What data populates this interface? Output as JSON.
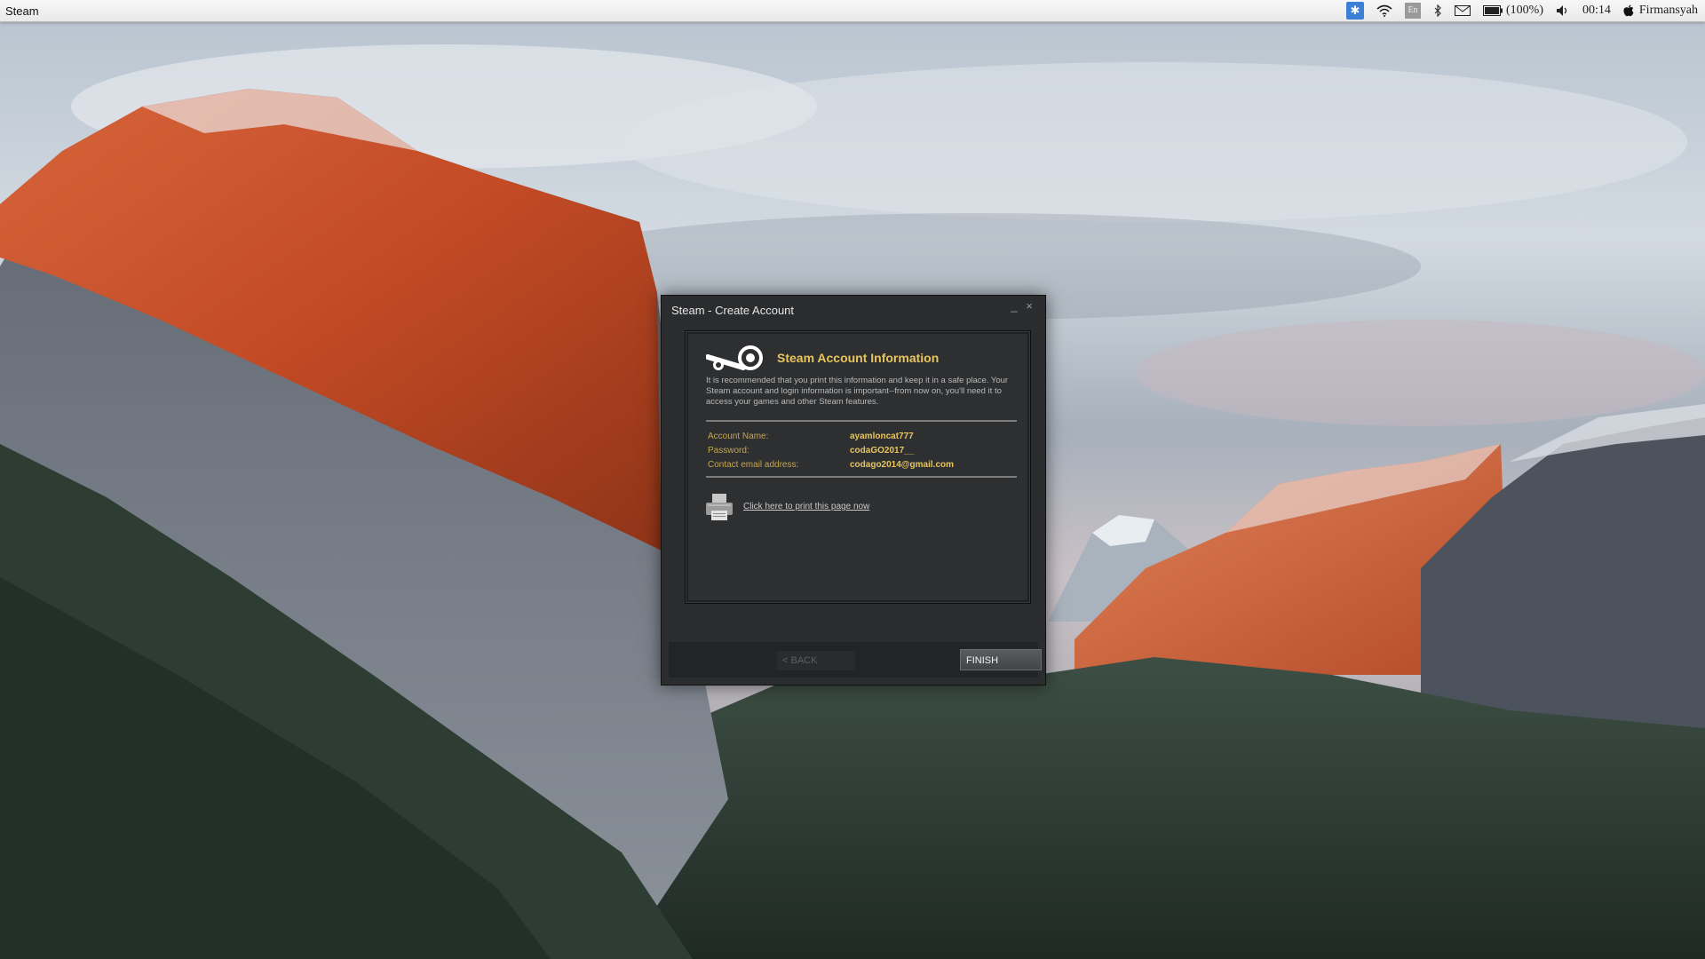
{
  "menubar": {
    "app_name": "Steam",
    "tray": {
      "app_icon": "blue-puzzle-icon",
      "wifi_icon": "wifi-icon",
      "language": "En",
      "bluetooth_icon": "bluetooth-icon",
      "mail_icon": "mail-icon",
      "battery_icon": "battery-icon",
      "battery_text": "(100%)",
      "volume_icon": "speaker-icon",
      "clock": "00:14",
      "apple_icon": "apple-icon",
      "user": "Firmansyah"
    }
  },
  "dialog": {
    "title": "Steam - Create Account",
    "minimize_label": "_",
    "close_label": "×",
    "heading": "Steam Account Information",
    "description": "It is recommended that you print this information and keep it in a safe place. Your Steam account and login information is important--from now on, you'll need it to access your games and other Steam features.",
    "fields": {
      "account_label": "Account Name:",
      "account_value": "ayamloncat777",
      "password_label": "Password:",
      "password_value": "codaGO2017__",
      "email_label": "Contact email address:",
      "email_value": "codago2014@gmail.com"
    },
    "print_link": "Click here to print this page now",
    "back_label": "< BACK",
    "finish_label": "FINISH"
  },
  "colors": {
    "accent_gold": "#e8c55d",
    "dialog_bg": "#2b2c2e",
    "menubar_bg": "#efefef"
  }
}
